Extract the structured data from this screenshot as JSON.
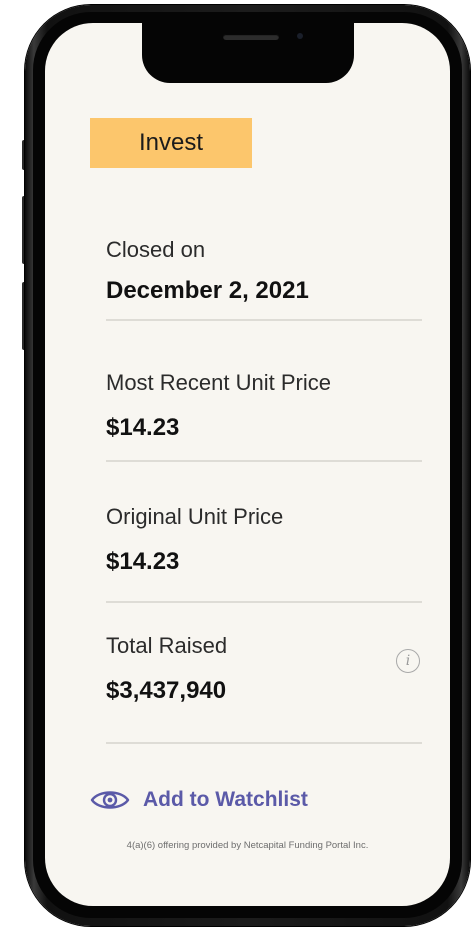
{
  "invest": {
    "label": "Invest"
  },
  "stats": [
    {
      "label": "Closed on",
      "value": "December 2, 2021"
    },
    {
      "label": "Most Recent Unit Price",
      "value": "$14.23"
    },
    {
      "label": "Original Unit Price",
      "value": "$14.23"
    },
    {
      "label": "Total Raised",
      "value": "$3,437,940"
    }
  ],
  "info": {
    "glyph": "i"
  },
  "watchlist": {
    "label": "Add to Watchlist",
    "icon": "eye-icon"
  },
  "footnote": "4(a)(6) offering provided by Netcapital Funding Portal Inc.",
  "colors": {
    "invest_bg": "#fcc66c",
    "screen_bg": "#f8f6f1",
    "watchlist": "#5b5aa8"
  }
}
